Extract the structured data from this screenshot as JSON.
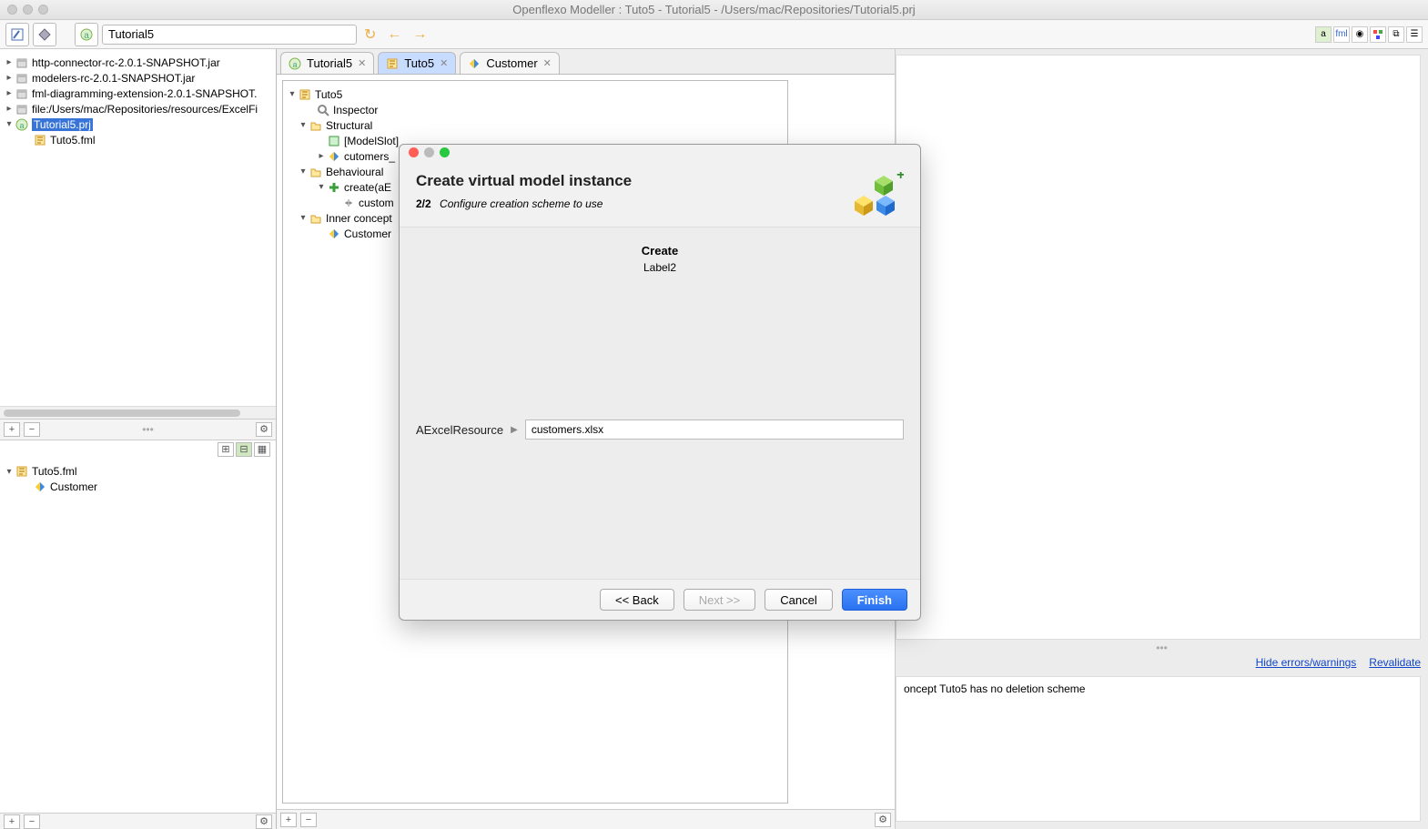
{
  "window": {
    "title": "Openflexo Modeller : Tuto5 - Tutorial5 - /Users/mac/Repositories/Tutorial5.prj"
  },
  "toolbar": {
    "breadcrumb": "Tutorial5"
  },
  "project_tree": [
    {
      "arrow": ">",
      "icon": "jar",
      "label": "http-connector-rc-2.0.1-SNAPSHOT.jar"
    },
    {
      "arrow": ">",
      "icon": "jar",
      "label": "modelers-rc-2.0.1-SNAPSHOT.jar"
    },
    {
      "arrow": ">",
      "icon": "jar",
      "label": "fml-diagramming-extension-2.0.1-SNAPSHOT."
    },
    {
      "arrow": ">",
      "icon": "jar",
      "label": "file:/Users/mac/Repositories/resources/ExcelFi"
    },
    {
      "arrow": "v",
      "icon": "prj",
      "label": "Tutorial5.prj",
      "selected": true
    },
    {
      "arrow": "",
      "icon": "fml",
      "label": "Tuto5.fml",
      "indent": 20
    }
  ],
  "lower_tree": [
    {
      "arrow": "v",
      "icon": "fml",
      "label": "Tuto5.fml"
    },
    {
      "arrow": "",
      "icon": "concept",
      "label": "Customer",
      "indent": 20
    }
  ],
  "tabs": [
    {
      "icon": "prj",
      "label": "Tutorial5",
      "active": false
    },
    {
      "icon": "fml",
      "label": "Tuto5",
      "active": true
    },
    {
      "icon": "concept",
      "label": "Customer",
      "active": false
    }
  ],
  "structure": [
    {
      "arrow": "v",
      "icon": "fml",
      "label": "Tuto5",
      "indent": 0
    },
    {
      "arrow": "",
      "icon": "inspector",
      "label": "Inspector",
      "indent": 20
    },
    {
      "arrow": "v",
      "icon": "folder",
      "label": "Structural",
      "indent": 12
    },
    {
      "arrow": "",
      "icon": "slot",
      "label": "[ModelSlot]",
      "indent": 32
    },
    {
      "arrow": ">",
      "icon": "concept",
      "label": "cutomers_",
      "indent": 32
    },
    {
      "arrow": "v",
      "icon": "folder",
      "label": "Behavioural",
      "indent": 12
    },
    {
      "arrow": "v",
      "icon": "plus",
      "label": "create(aE",
      "indent": 32
    },
    {
      "arrow": "",
      "icon": "link",
      "label": "custom",
      "indent": 48
    },
    {
      "arrow": "v",
      "icon": "folder",
      "label": "Inner concept",
      "indent": 12
    },
    {
      "arrow": "",
      "icon": "concept",
      "label": "Customer",
      "indent": 32
    }
  ],
  "dialog": {
    "title": "Create virtual model instance",
    "step": "2/2",
    "step_desc": "Configure creation scheme to use",
    "create_label": "Create",
    "create_sub": "Label2",
    "field_label": "AExcelResource",
    "field_value": "customers.xlsx",
    "buttons": {
      "back": "<< Back",
      "next": "Next >>",
      "cancel": "Cancel",
      "finish": "Finish"
    }
  },
  "right": {
    "link_hide": "Hide errors/warnings",
    "link_revalidate": "Revalidate",
    "message": "oncept Tuto5 has no deletion scheme"
  }
}
